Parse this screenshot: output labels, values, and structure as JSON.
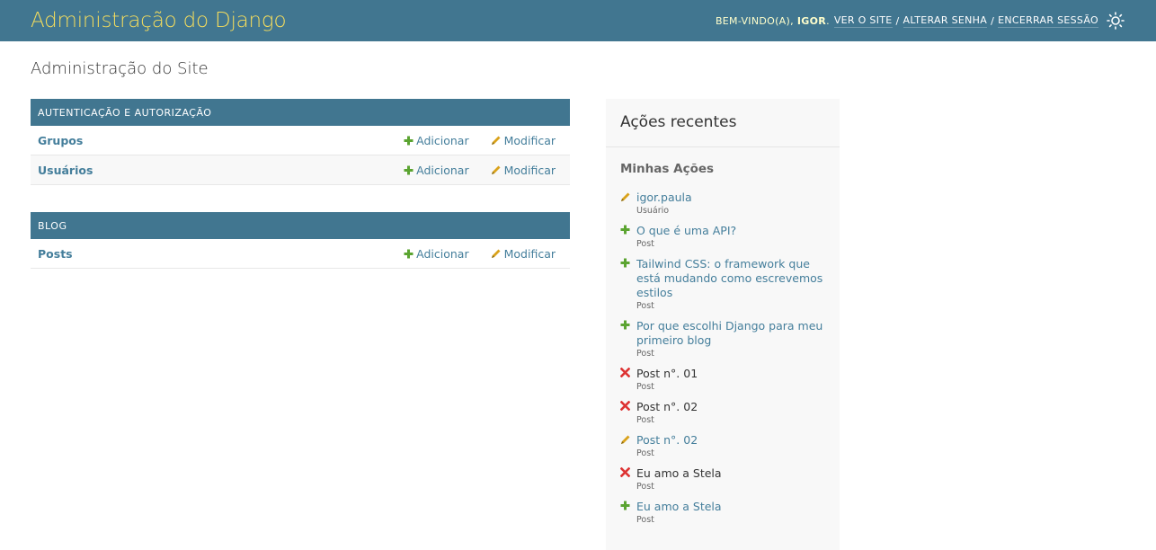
{
  "header": {
    "site_name": "Administração do Django",
    "welcome": "Bem-vindo(a),",
    "username": "Igor",
    "links": [
      "Ver o site",
      "Alterar senha",
      "Encerrar sessão"
    ]
  },
  "page_title": "Administração do Site",
  "modules": [
    {
      "caption": "Autenticação e Autorização",
      "models": [
        {
          "name": "Grupos",
          "add": "Adicionar",
          "change": "Modificar"
        },
        {
          "name": "Usuários",
          "add": "Adicionar",
          "change": "Modificar"
        }
      ]
    },
    {
      "caption": "Blog",
      "models": [
        {
          "name": "Posts",
          "add": "Adicionar",
          "change": "Modificar"
        }
      ]
    }
  ],
  "recent_actions": {
    "title": "Ações recentes",
    "subtitle": "Minhas Ações",
    "items": [
      {
        "icon": "change-icon",
        "title": "igor.paula",
        "type": "Usuário"
      },
      {
        "icon": "add-icon",
        "title": "O que é uma API?",
        "type": "Post"
      },
      {
        "icon": "add-icon",
        "title": "Tailwind CSS: o framework que está mudando como escrevemos estilos",
        "type": "Post"
      },
      {
        "icon": "add-icon",
        "title": "Por que escolhi Django para meu primeiro blog",
        "type": "Post"
      },
      {
        "icon": "delete-icon",
        "title": "Post n°. 01",
        "type": "Post"
      },
      {
        "icon": "delete-icon",
        "title": "Post n°. 02",
        "type": "Post"
      },
      {
        "icon": "change-icon",
        "title": "Post n°. 02",
        "type": "Post"
      },
      {
        "icon": "delete-icon",
        "title": "Eu amo a Stela",
        "type": "Post"
      },
      {
        "icon": "add-icon",
        "title": "Eu amo a Stela",
        "type": "Post"
      }
    ]
  },
  "colors": {
    "header_bg": "#417690",
    "site_name": "#f5dd5d",
    "link": "#447e9b",
    "add_green": "#5ba431",
    "change_yellow": "#d9a21b",
    "delete_red": "#dd3333"
  }
}
